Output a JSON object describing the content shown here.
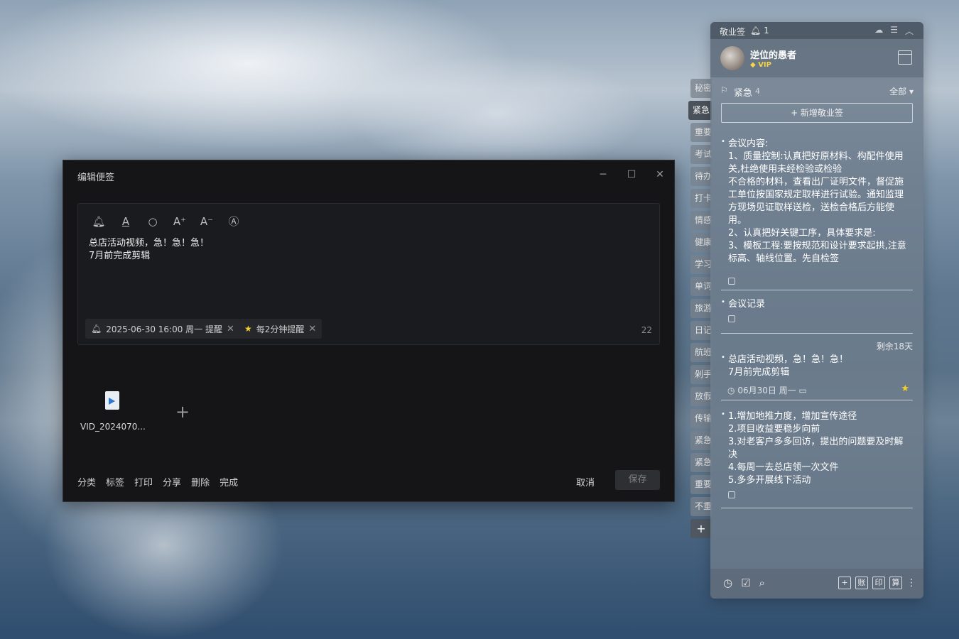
{
  "edit_window": {
    "title": "编辑便签",
    "content_lines": [
      "总店活动视频，急！急！急！",
      "7月前完成剪辑"
    ],
    "reminder_chip": "2025-06-30 16:00 周一 提醒",
    "repeat_chip": "每2分钟提醒",
    "char_count": "22",
    "attachment_name": "VID_2024070...",
    "bottom_actions": [
      "分类",
      "标签",
      "打印",
      "分享",
      "删除",
      "完成"
    ],
    "cancel_label": "取消",
    "save_label": "保存",
    "icons": {
      "bell": "bell-icon",
      "font_color": "font-color-icon",
      "search": "search-icon",
      "font_increase": "font-increase-icon",
      "font_decrease": "font-decrease-icon",
      "auto_format": "auto-format-icon"
    }
  },
  "side_tabs": [
    "秘密",
    "紧急",
    "重要",
    "考试",
    "待办",
    "打卡",
    "情感",
    "健康",
    "学习",
    "单词",
    "旅游",
    "日记",
    "航班",
    "剁手",
    "放假",
    "传输",
    "紧急",
    "紧急",
    "重要",
    "不重"
  ],
  "side_tab_active_index": 1,
  "note_panel": {
    "app_name": "敬业签",
    "notification_count": "1",
    "user": {
      "name": "逆位的愚者",
      "badge": "VIP"
    },
    "category": {
      "name": "紧急",
      "count": "4",
      "filter": "全部"
    },
    "new_note_label": "+ 新增敬业签",
    "notes": [
      {
        "lines": [
          "会议内容:",
          "1、质量控制:认真把好原材料、构配件使用",
          "关,杜绝使用未经检验或检验",
          "不合格的材料，查看出厂证明文件，督促施",
          "工单位按国家规定取样进行试验。通知监理",
          "方现场见证取样送检，送检合格后方能使",
          "用。",
          "2、认真把好关键工序，具体要求是:",
          "3、模板工程:要按规范和设计要求起拱,注意",
          "标高、轴线位置。先自检签"
        ]
      },
      {
        "lines": [
          "会议记录"
        ]
      },
      {
        "remaining": "剩余18天",
        "lines": [
          "总店活动视频，急！急！急！",
          "7月前完成剪辑"
        ],
        "date": "06月30日 周一"
      },
      {
        "lines": [
          "1.增加地推力度，增加宣传途径",
          "2.项目收益要稳步向前",
          "3.对老客户多多回访，提出的问题要及时解",
          "决",
          "4.每周一去总店领一次文件",
          "5.多多开展线下活动"
        ]
      }
    ],
    "footer_buttons": [
      "+",
      "账",
      "印",
      "算"
    ],
    "colors": {
      "star": "#f5cf2a",
      "vip": "#f5d44a",
      "panel": "#6e7d8c"
    }
  }
}
